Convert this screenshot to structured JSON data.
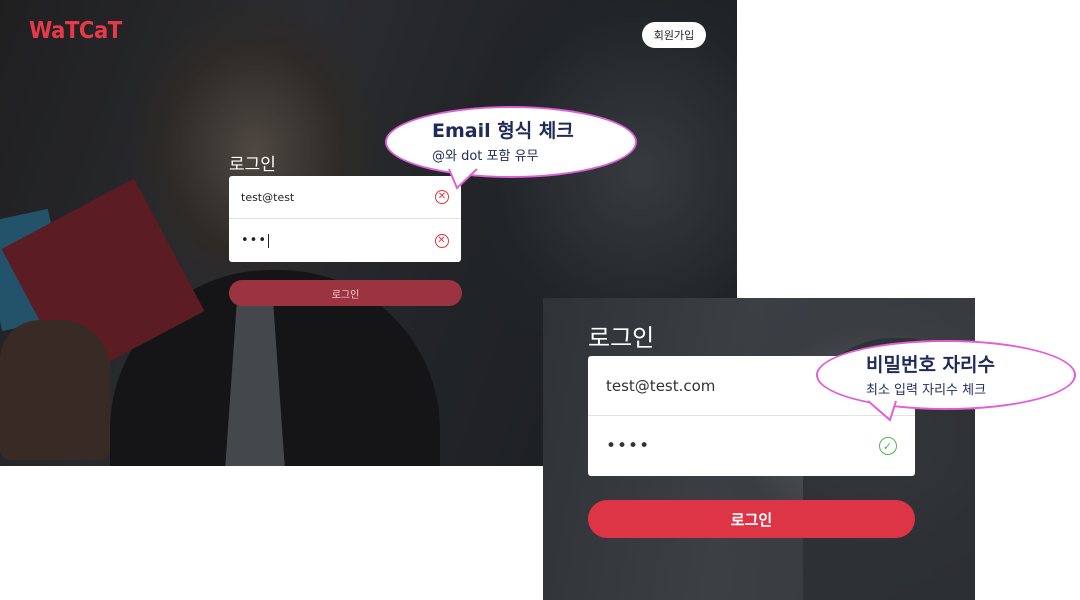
{
  "app": {
    "logo_text": "WaTCaT",
    "brand_color": "#e63a4a"
  },
  "header": {
    "signup_label": "회원가입"
  },
  "screen_main": {
    "form_title": "로그인",
    "email_value": "test@test",
    "password_value": "•••",
    "login_label": "로그인",
    "email_status_icon": "error-circle-icon",
    "password_status_icon": "error-circle-icon"
  },
  "screen_zoom": {
    "form_title": "로그인",
    "email_value": "test@test.com",
    "password_value": "••••",
    "login_label": "로그인",
    "password_status_icon": "check-circle-icon"
  },
  "callouts": {
    "email": {
      "title": "Email 형식 체크",
      "subtitle": "@와 dot 포함 유무"
    },
    "password": {
      "title": "비밀번호 자리수",
      "subtitle": "최소 입력 자리수 체크"
    }
  },
  "colors": {
    "error": "#e3343f",
    "success": "#52b35c",
    "login_button": "#dd3545",
    "callout_border": "#e05fd6",
    "callout_text": "#1f2a5b"
  }
}
